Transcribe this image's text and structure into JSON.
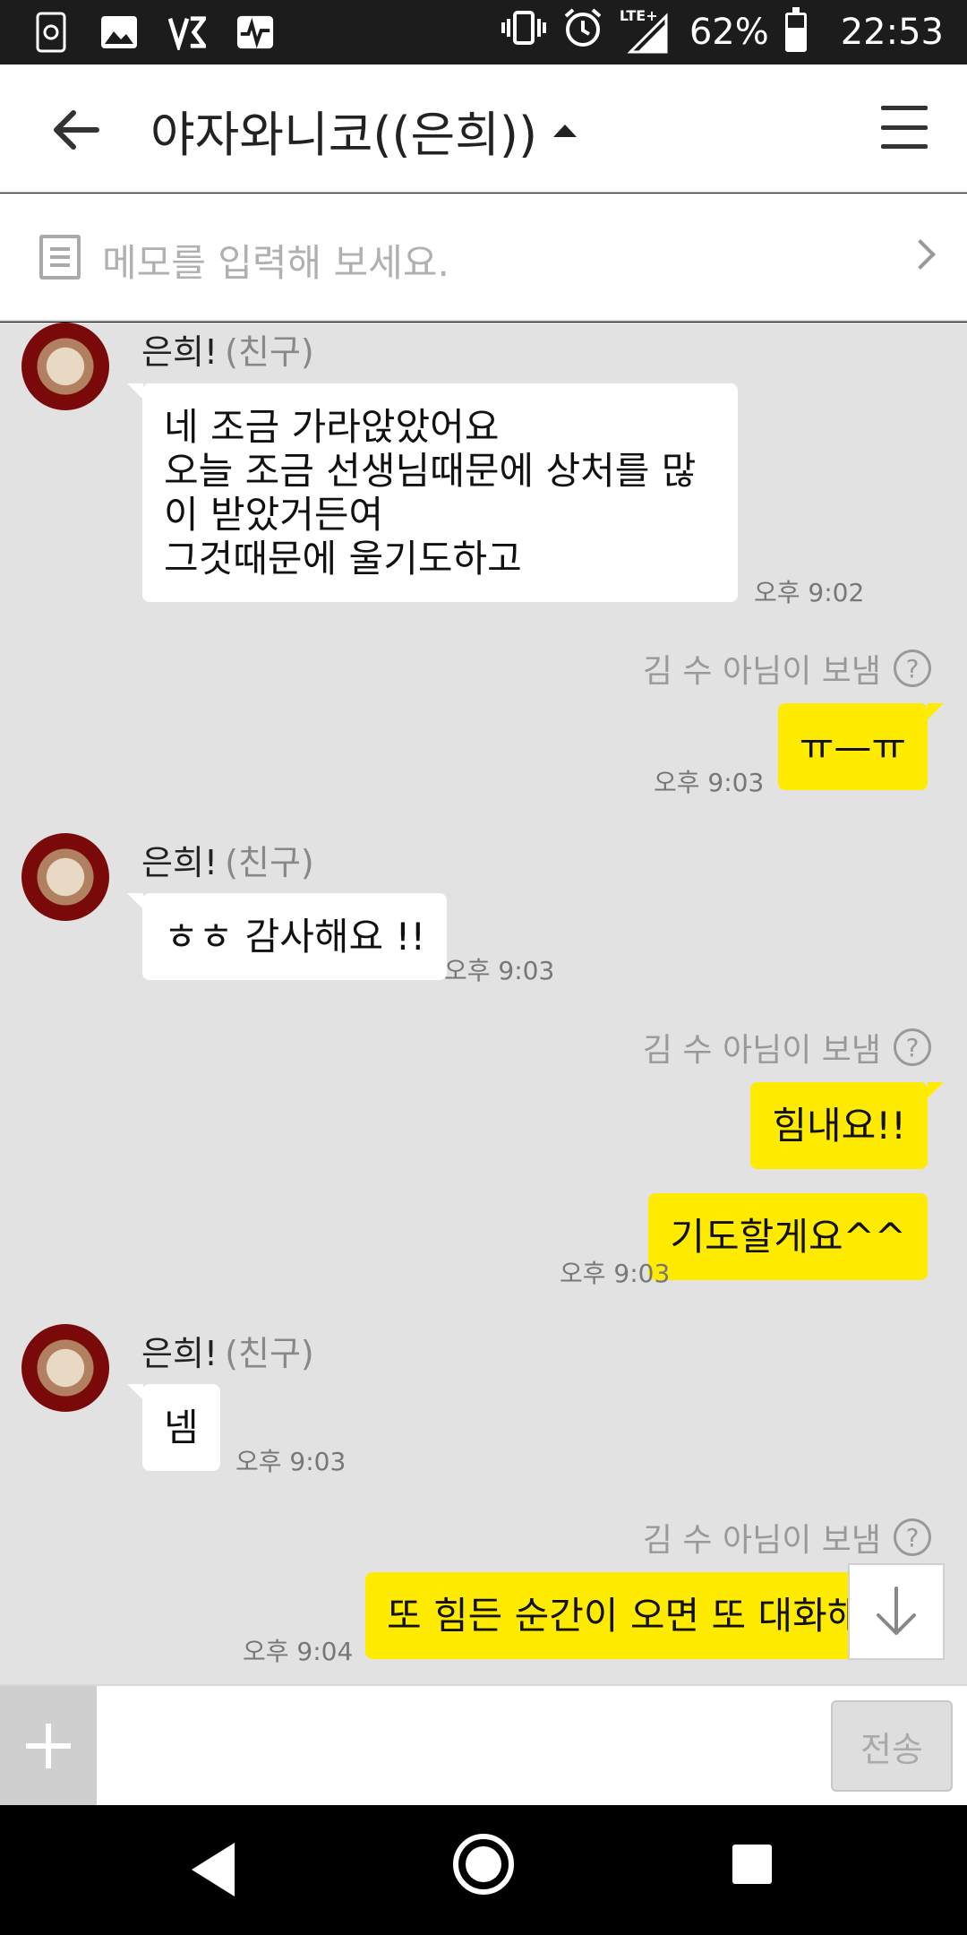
{
  "status_bar": {
    "left_icons": [
      "screenshot-app-icon",
      "image-icon",
      "vpn-app-icon",
      "activity-app-icon"
    ],
    "right_icons": [
      "vibrate-icon",
      "alarm-icon",
      "lte-signal-icon",
      "battery-icon"
    ],
    "network": "LTE+",
    "battery": "62%",
    "battery_level": 0.62,
    "time": "22:53"
  },
  "header": {
    "title": "야자와니코((은희))"
  },
  "memo": {
    "placeholder": "메모를 입력해 보세요."
  },
  "messages": [
    {
      "type": "in",
      "sender": "은희!",
      "relation": "(친구)",
      "lines": [
        "네 조금 가라앉았어요",
        "오늘 조금 선생님때문에 상처를 많",
        "이 받았거든여",
        "그것때문에 울기도하고"
      ],
      "time": "오후 9:02"
    },
    {
      "type": "sent_by",
      "text": "김 수 아님이 보냄"
    },
    {
      "type": "out",
      "text": "ㅠ—ㅠ",
      "time": "오후 9:03"
    },
    {
      "type": "in",
      "sender": "은희!",
      "relation": "(친구)",
      "text": "ㅎㅎ 감사해요 !!",
      "time": "오후 9:03"
    },
    {
      "type": "sent_by",
      "text": "김 수 아님이 보냄"
    },
    {
      "type": "out",
      "text": "힘내요!!"
    },
    {
      "type": "out",
      "text": "기도할게요^^",
      "time": "오후 9:03"
    },
    {
      "type": "in",
      "sender": "은희!",
      "relation": "(친구)",
      "text": "넴",
      "time": "오후 9:03"
    },
    {
      "type": "sent_by",
      "text": "김 수 아님이 보냄"
    },
    {
      "type": "out",
      "text": "또 힘든 순간이 오면 또 대화해",
      "time": "오후 9:04"
    }
  ],
  "input": {
    "value": "",
    "send_label": "전송"
  },
  "colors": {
    "chat_bg": "#e2e2e2",
    "outgoing_bubble": "#ffeb00",
    "incoming_bubble": "#ffffff"
  }
}
